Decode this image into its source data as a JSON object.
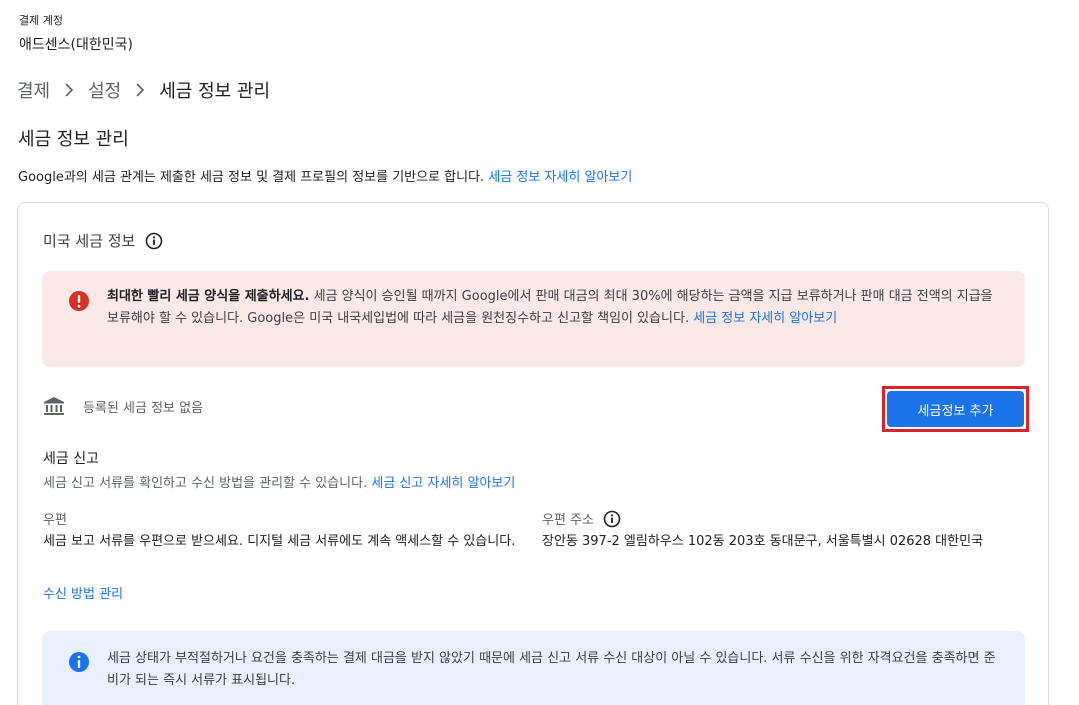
{
  "account": {
    "label": "결제 계정",
    "name": "애드센스(대한민국)"
  },
  "breadcrumb": [
    "결제",
    "설정",
    "세금 정보 관리"
  ],
  "page_title": "세금 정보 관리",
  "intro": {
    "text": "Google과의 세금 관계는 제출한 세금 정보 및 결제 프로필의 정보를 기반으로 합니다. ",
    "link": "세금 정보 자세히 알아보기"
  },
  "us_tax": {
    "title": "미국 세금 정보",
    "alert": {
      "bold": "최대한 빨리 세금 양식을 제출하세요.",
      "text": " 세금 양식이 승인될 때까지 Google에서 판매 대금의 최대 30%에 해당하는 금액을 지급 보류하거나 판매 대금 전액의 지급을 보류해야 할 수 있습니다. Google은 미국 내국세입법에 따라 세금을 원천징수하고 신고할 책임이 있습니다. ",
      "link": "세금 정보 자세히 알아보기"
    },
    "no_info": "등록된 세금 정보 없음",
    "add_button": "세금정보 추가"
  },
  "tax_filing": {
    "title": "세금 신고",
    "desc": "세금 신고 서류를 확인하고 수신 방법을 관리할 수 있습니다. ",
    "link": "세금 신고 자세히 알아보기",
    "mail_label": "우편",
    "mail_text": "세금 보고 서류를 우편으로 받으세요. 디지털 세금 서류에도 계속 액세스할 수 있습니다.",
    "address_label": "우편 주소",
    "address_text": "장안동 397-2 엘림하우스 102동 203호 동대문구, 서울특별시 02628 대한민국",
    "manage_link": "수신 방법 관리",
    "notice": "세금 상태가 부적절하거나 요건을 충족하는 결제 대금을 받지 않았기 때문에 세금 신고 서류 수신 대상이 아닐 수 있습니다. 서류 수신을 위한 자격요건을 충족하면 준비가 되는 즉시 서류가 표시됩니다."
  },
  "colors": {
    "link": "#1a73e8",
    "error": "#d93025",
    "alert_bg": "#fce8e6",
    "info_bg": "#e8f0fe",
    "button": "#1a73e8",
    "highlight": "#d8232a"
  },
  "icons": {
    "chevron": "chevron-right-icon",
    "info": "info-outline-icon",
    "error": "error-icon",
    "bank": "bank-icon",
    "notice": "info-filled-icon"
  }
}
